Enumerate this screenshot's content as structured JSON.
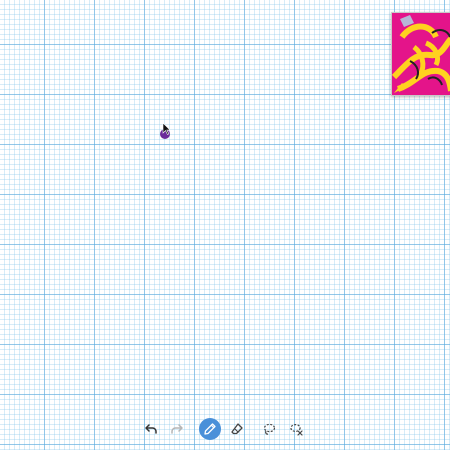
{
  "canvas": {
    "background": "#ffffff",
    "grid_color": "#5aaadc",
    "brush_color": "#6a2a9a"
  },
  "thumbnail": {
    "background": "#e4148a",
    "accent": "#ffd21f"
  },
  "toolbar": {
    "tools": [
      {
        "name": "undo",
        "icon": "undo-icon",
        "active": false,
        "enabled": true
      },
      {
        "name": "redo",
        "icon": "redo-icon",
        "active": false,
        "enabled": false
      },
      {
        "name": "pencil",
        "icon": "pencil-icon",
        "active": true,
        "enabled": true
      },
      {
        "name": "eraser",
        "icon": "eraser-icon",
        "active": false,
        "enabled": true
      },
      {
        "name": "lasso",
        "icon": "lasso-icon",
        "active": false,
        "enabled": true
      },
      {
        "name": "lasso-clear",
        "icon": "lasso-clear-icon",
        "active": false,
        "enabled": true
      }
    ],
    "active_color": "#4a90d9"
  }
}
